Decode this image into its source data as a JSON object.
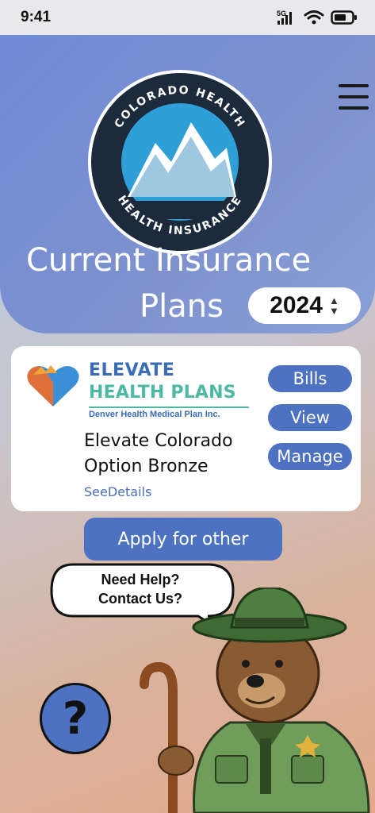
{
  "status_bar": {
    "time": "9:41",
    "network": "5G"
  },
  "logo": {
    "top_text": "COLORADO HEALTH",
    "bottom_text": "HEALTH INSURANCE"
  },
  "header": {
    "title_line1": "Current Insurance",
    "title_line2": "Plans",
    "year": "2024"
  },
  "plan_card": {
    "brand_line1": "ELEVATE",
    "brand_line2": "HEALTH PLANS",
    "brand_sub": "Denver Health Medical Plan Inc.",
    "plan_name": "Elevate Colorado Option Bronze",
    "details_link": "SeeDetails",
    "buttons": {
      "bills": "Bills",
      "view": "View",
      "manage": "Manage"
    }
  },
  "apply_button": "Apply for other",
  "help": {
    "bubble_line1": "Need Help?",
    "bubble_line2": "Contact Us?",
    "button_symbol": "?"
  },
  "colors": {
    "accent": "#4d72c2",
    "header": "#7f92cf",
    "brand_blue": "#3a6db5",
    "brand_teal": "#4db9a3"
  }
}
